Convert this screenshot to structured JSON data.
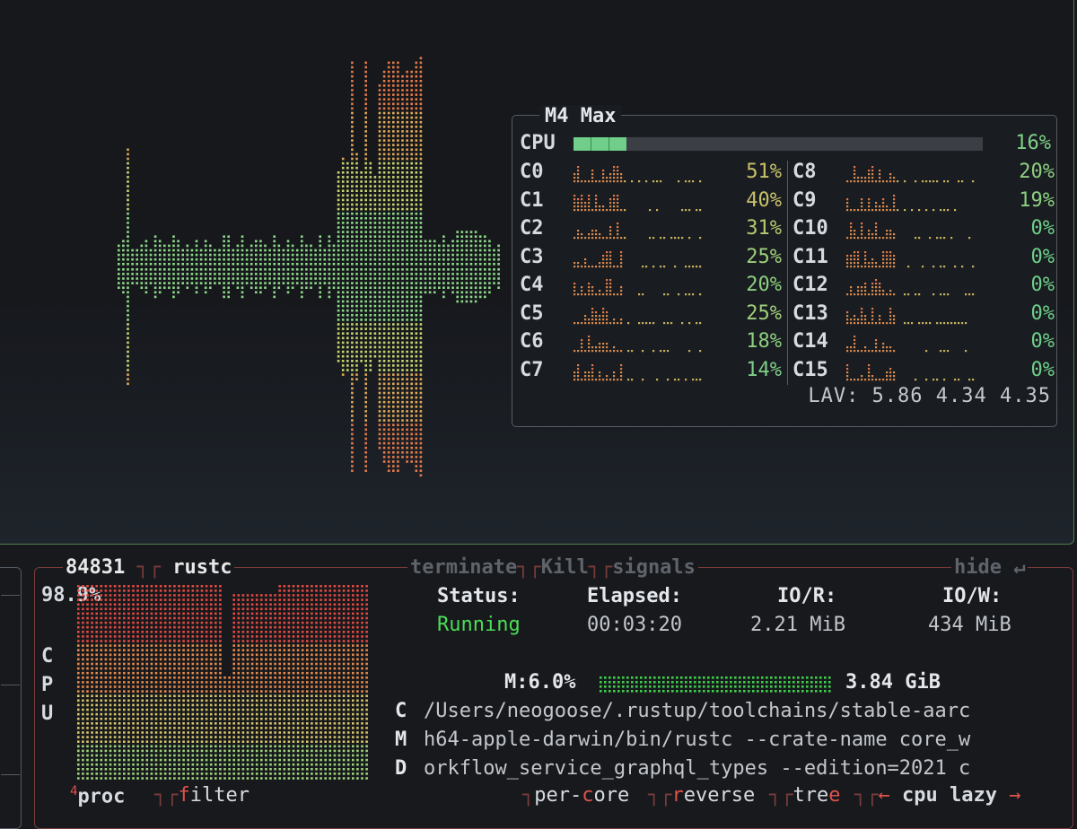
{
  "cpu_panel": {
    "title": "M4 Max",
    "cpu_label": "CPU",
    "cpu_total_percent": "16%",
    "cpu_total_fraction": 0.13,
    "cores_left": [
      {
        "label": "C0",
        "percent": "51%",
        "color": "#c9c26a"
      },
      {
        "label": "C1",
        "percent": "40%",
        "color": "#c9c26a"
      },
      {
        "label": "C2",
        "percent": "31%",
        "color": "#b3c96f"
      },
      {
        "label": "C3",
        "percent": "25%",
        "color": "#9fcf7a"
      },
      {
        "label": "C4",
        "percent": "20%",
        "color": "#8ccf80"
      },
      {
        "label": "C5",
        "percent": "25%",
        "color": "#9fcf7a"
      },
      {
        "label": "C6",
        "percent": "18%",
        "color": "#8ccf80"
      },
      {
        "label": "C7",
        "percent": "14%",
        "color": "#7fcf88"
      }
    ],
    "cores_right": [
      {
        "label": "C8",
        "percent": "20%",
        "color": "#8ccf80"
      },
      {
        "label": "C9",
        "percent": "19%",
        "color": "#8ccf80"
      },
      {
        "label": "C10",
        "percent": "0%",
        "color": "#6fcf8a"
      },
      {
        "label": "C11",
        "percent": "0%",
        "color": "#6fcf8a"
      },
      {
        "label": "C12",
        "percent": "0%",
        "color": "#6fcf8a"
      },
      {
        "label": "C13",
        "percent": "0%",
        "color": "#6fcf8a"
      },
      {
        "label": "C14",
        "percent": "0%",
        "color": "#6fcf8a"
      },
      {
        "label": "C15",
        "percent": "0%",
        "color": "#6fcf8a"
      }
    ],
    "lav": "LAV: 5.86 4.34 4.35"
  },
  "process": {
    "pid": "84831",
    "name": "rustc",
    "cpu_percent": "98.9%",
    "cpu_vertical_label": [
      "C",
      "P",
      "U"
    ],
    "buttons": {
      "terminate": "terminate",
      "kill": "Kill",
      "signals": "signals",
      "hide": "hide"
    },
    "status_label": "Status:",
    "status_value": "Running",
    "elapsed_label": "Elapsed:",
    "elapsed_value": "00:03:20",
    "ior_label": "IO/R:",
    "ior_value": "2.21 MiB",
    "iow_label": "IO/W:",
    "iow_value": "434 MiB",
    "mem_label": "M:6.0%",
    "mem_value": "3.84 GiB",
    "cmd_letters": [
      "C",
      "M",
      "D"
    ],
    "cmd_lines": [
      "/Users/neogoose/.rustup/toolchains/stable-aarc",
      "h64-apple-darwin/bin/rustc --crate-name core_w",
      "orkflow_service_graphql_types --edition=2021 c"
    ]
  },
  "bottom_bar": {
    "proc_number": "4",
    "proc_label": "proc",
    "filter_hotkey": "f",
    "filter_rest": "ilter",
    "percore_prefix": "per-",
    "percore_hotkey": "c",
    "percore_suffix": "ore",
    "reverse_hotkey": "r",
    "reverse_rest": "everse",
    "tree_prefix": "tre",
    "tree_hotkey": "e",
    "sort_left_arrow": "←",
    "sort_label": "cpu lazy",
    "sort_right_arrow": "→"
  },
  "colors": {
    "accent_green": "#4ade56",
    "hotkey_red": "#e0524c",
    "proc_border": "#7a3c3a",
    "top_border": "#4f7d4f"
  }
}
